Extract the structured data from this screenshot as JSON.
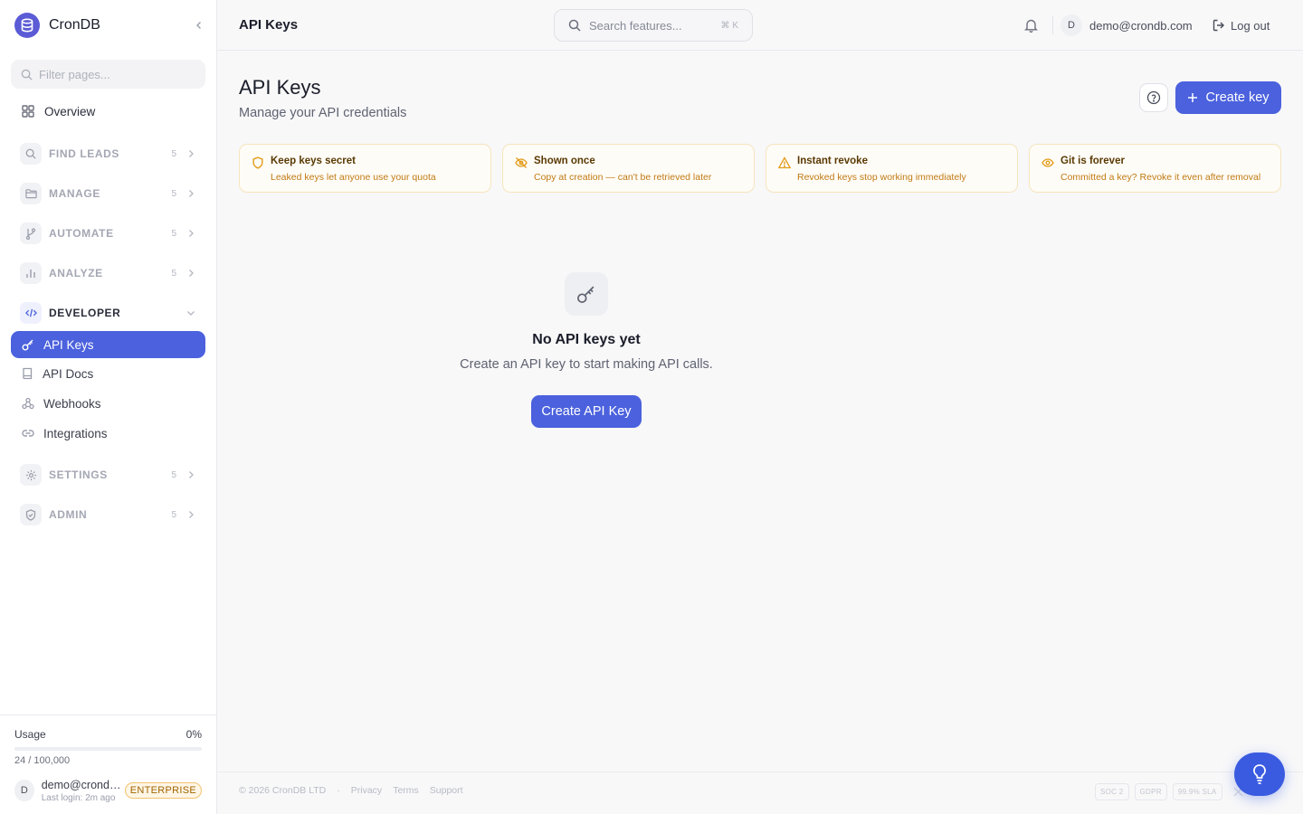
{
  "brand": {
    "name": "CronDB"
  },
  "sidebar": {
    "filter_placeholder": "Filter pages...",
    "overview_label": "Overview",
    "groups": [
      {
        "label": "FIND LEADS",
        "count": "5",
        "icon": "search-icon"
      },
      {
        "label": "MANAGE",
        "count": "5",
        "icon": "folder-icon"
      },
      {
        "label": "AUTOMATE",
        "count": "5",
        "icon": "branch-icon"
      },
      {
        "label": "ANALYZE",
        "count": "5",
        "icon": "bar-chart-icon"
      },
      {
        "label": "DEVELOPER",
        "count": "",
        "icon": "code-icon"
      },
      {
        "label": "SETTINGS",
        "count": "5",
        "icon": "gear-icon"
      },
      {
        "label": "ADMIN",
        "count": "5",
        "icon": "shield-icon"
      }
    ],
    "developer_items": [
      {
        "label": "API Keys",
        "icon": "key-icon",
        "active": true
      },
      {
        "label": "API Docs",
        "icon": "book-icon"
      },
      {
        "label": "Webhooks",
        "icon": "webhook-icon"
      },
      {
        "label": "Integrations",
        "icon": "link-icon"
      }
    ],
    "usage": {
      "label": "Usage",
      "percent_label": "0%",
      "fraction": 0.0,
      "count_text": "24 / 100,000"
    },
    "user": {
      "avatar_initial": "D",
      "email": "demo@crondb...",
      "last_login": "Last login: 2m ago",
      "plan": "ENTERPRISE"
    }
  },
  "topbar": {
    "title": "API Keys",
    "search_placeholder": "Search features...",
    "shortcut": "⌘ K",
    "user_initial": "D",
    "user_email": "demo@crondb.com",
    "logout_label": "Log out"
  },
  "main": {
    "title": "API Keys",
    "subtitle": "Manage your API credentials",
    "create_label": "Create key",
    "tips": [
      {
        "title": "Keep keys secret",
        "desc": "Leaked keys let anyone use your quota",
        "icon": "shield-icon"
      },
      {
        "title": "Shown once",
        "desc": "Copy at creation — can't be retrieved later",
        "icon": "eye-off-icon"
      },
      {
        "title": "Instant revoke",
        "desc": "Revoked keys stop working immediately",
        "icon": "warning-icon"
      },
      {
        "title": "Git is forever",
        "desc": "Committed a key? Revoke it even after removal",
        "icon": "eye-icon"
      }
    ],
    "empty": {
      "title": "No API keys yet",
      "desc": "Create an API key to start making API calls.",
      "button_label": "Create API Key"
    }
  },
  "footer": {
    "copyright": "© 2026 CronDB LTD",
    "separator": "·",
    "links": [
      "Privacy",
      "Terms",
      "Support"
    ],
    "badges": [
      "SOC 2",
      "GDPR",
      "99.9% SLA"
    ]
  },
  "colors": {
    "accent": "#4b61dd",
    "warning_text": "#c17a15",
    "brand": "#5b5bd6"
  }
}
